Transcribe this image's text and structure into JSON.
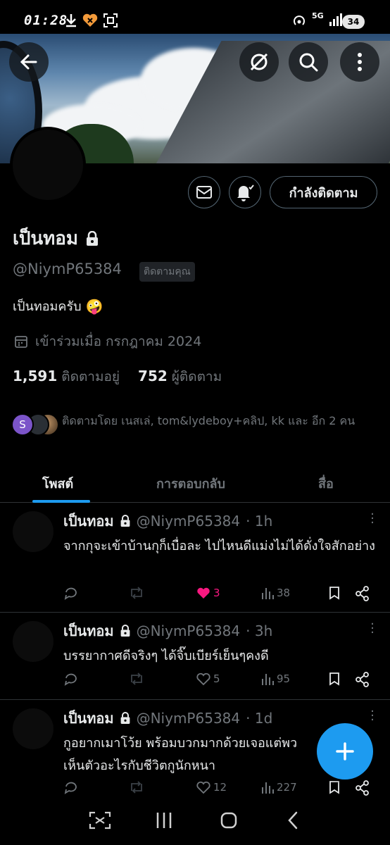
{
  "status_bar": {
    "time": "01:28",
    "network": "5G",
    "battery": "34"
  },
  "profile": {
    "name": "เป็นทอม",
    "handle": "@NiymP65384",
    "follows_you_badge": "ติดตามคุณ",
    "bio": "เป็นทอมครับ",
    "bio_emoji": "🤪",
    "joined": "เข้าร่วมเมื่อ กรกฎาคม 2024",
    "following_count": "1,591",
    "following_label": "ติดตามอยู่",
    "followers_count": "752",
    "followers_label": "ผู้ติดตาม",
    "followed_by_text": "ติดตามโดย เนสเล่, tom&lydeboy+คลิป, kk และ อีก 2 คน",
    "followed_by_initial": "S"
  },
  "buttons": {
    "following": "กำลังติดตาม"
  },
  "tabs": [
    {
      "label": "โพสต์",
      "active": true
    },
    {
      "label": "การตอบกลับ",
      "active": false
    },
    {
      "label": "สื่อ",
      "active": false
    }
  ],
  "posts": [
    {
      "name": "เป็นทอม",
      "handle": "@NiymP65384",
      "time": "· 1h",
      "text": "จากกุจะเข้าบ้านกุก็เบื่อละ ไปไหนดีแม่งไม่ได้ดั่งใจสักอย่าง",
      "likes": "3",
      "liked": true,
      "views": "38"
    },
    {
      "name": "เป็นทอม",
      "handle": "@NiymP65384",
      "time": "· 3h",
      "text": "บรรยากาศดีจริงๆ ได้จิ๊บเบียร์เย็นๆคงดี",
      "likes": "5",
      "liked": false,
      "views": "95"
    },
    {
      "name": "เป็นทอม",
      "handle": "@NiymP65384",
      "time": "· 1d",
      "text": "กูอยากเมาโว้ย พร้อมบวกมากด้วยเจอแต่พว",
      "text2": "เห็นตัวอะไรกับชีวิตกูนักหนา",
      "likes": "12",
      "liked": false,
      "views": "227"
    }
  ],
  "colors": {
    "accent": "#1d9bf0",
    "like": "#f91880",
    "secondary_text": "#71767b"
  }
}
